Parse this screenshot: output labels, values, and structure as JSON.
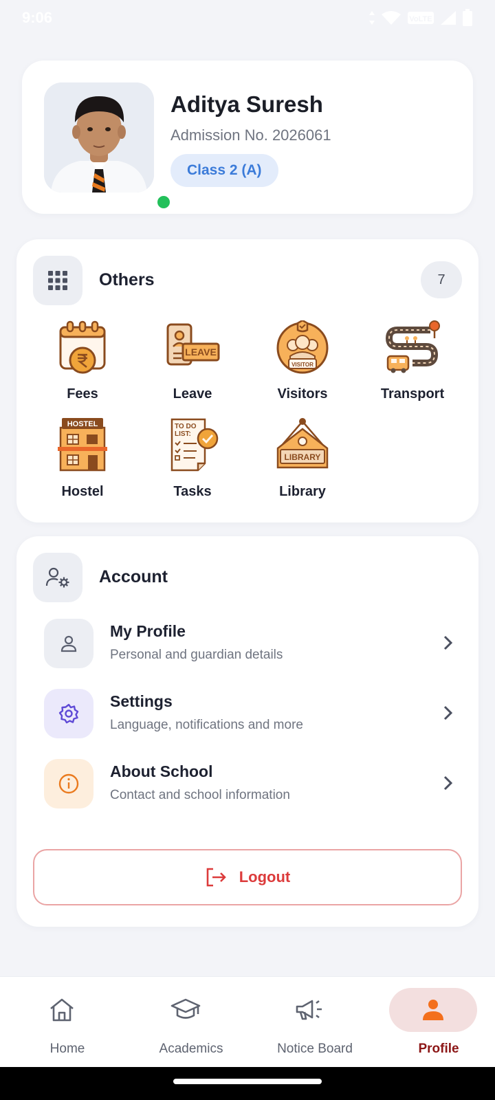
{
  "status_bar": {
    "time": "9:06",
    "network_label": "VoLTE"
  },
  "profile": {
    "name": "Aditya Suresh",
    "admission": "Admission No. 2026061",
    "class_chip": "Class 2 (A)",
    "online_color": "#22c05a"
  },
  "others": {
    "title": "Others",
    "count": "7",
    "items": [
      {
        "label": "Fees",
        "icon": "fees-rupee-calendar-icon"
      },
      {
        "label": "Leave",
        "icon": "leave-icon"
      },
      {
        "label": "Visitors",
        "icon": "visitors-icon"
      },
      {
        "label": "Transport",
        "icon": "transport-bus-route-icon"
      },
      {
        "label": "Hostel",
        "icon": "hostel-building-icon"
      },
      {
        "label": "Tasks",
        "icon": "todo-list-icon"
      },
      {
        "label": "Library",
        "icon": "library-sign-icon"
      }
    ],
    "illustration_text": {
      "leave": "LEAVE",
      "visitor": "VISITOR",
      "hostel": "HOSTEL",
      "todo": "TO DO",
      "list": "LIST:",
      "library": "LIBRARY"
    }
  },
  "account": {
    "title": "Account",
    "rows": [
      {
        "title": "My Profile",
        "subtitle": "Personal and guardian details",
        "icon": "user-icon",
        "color": "#eceef3"
      },
      {
        "title": "Settings",
        "subtitle": "Language, notifications and more",
        "icon": "settings-gear-icon",
        "color": "#ebe9fb"
      },
      {
        "title": "About School",
        "subtitle": "Contact and school information",
        "icon": "info-icon",
        "color": "#fdeedd"
      }
    ],
    "logout_label": "Logout"
  },
  "nav": {
    "items": [
      {
        "label": "Home",
        "icon": "home-icon",
        "active": false
      },
      {
        "label": "Academics",
        "icon": "graduation-cap-icon",
        "active": false
      },
      {
        "label": "Notice Board",
        "icon": "megaphone-icon",
        "active": false
      },
      {
        "label": "Profile",
        "icon": "person-icon",
        "active": true
      }
    ],
    "active_color": "#f36f1c"
  }
}
